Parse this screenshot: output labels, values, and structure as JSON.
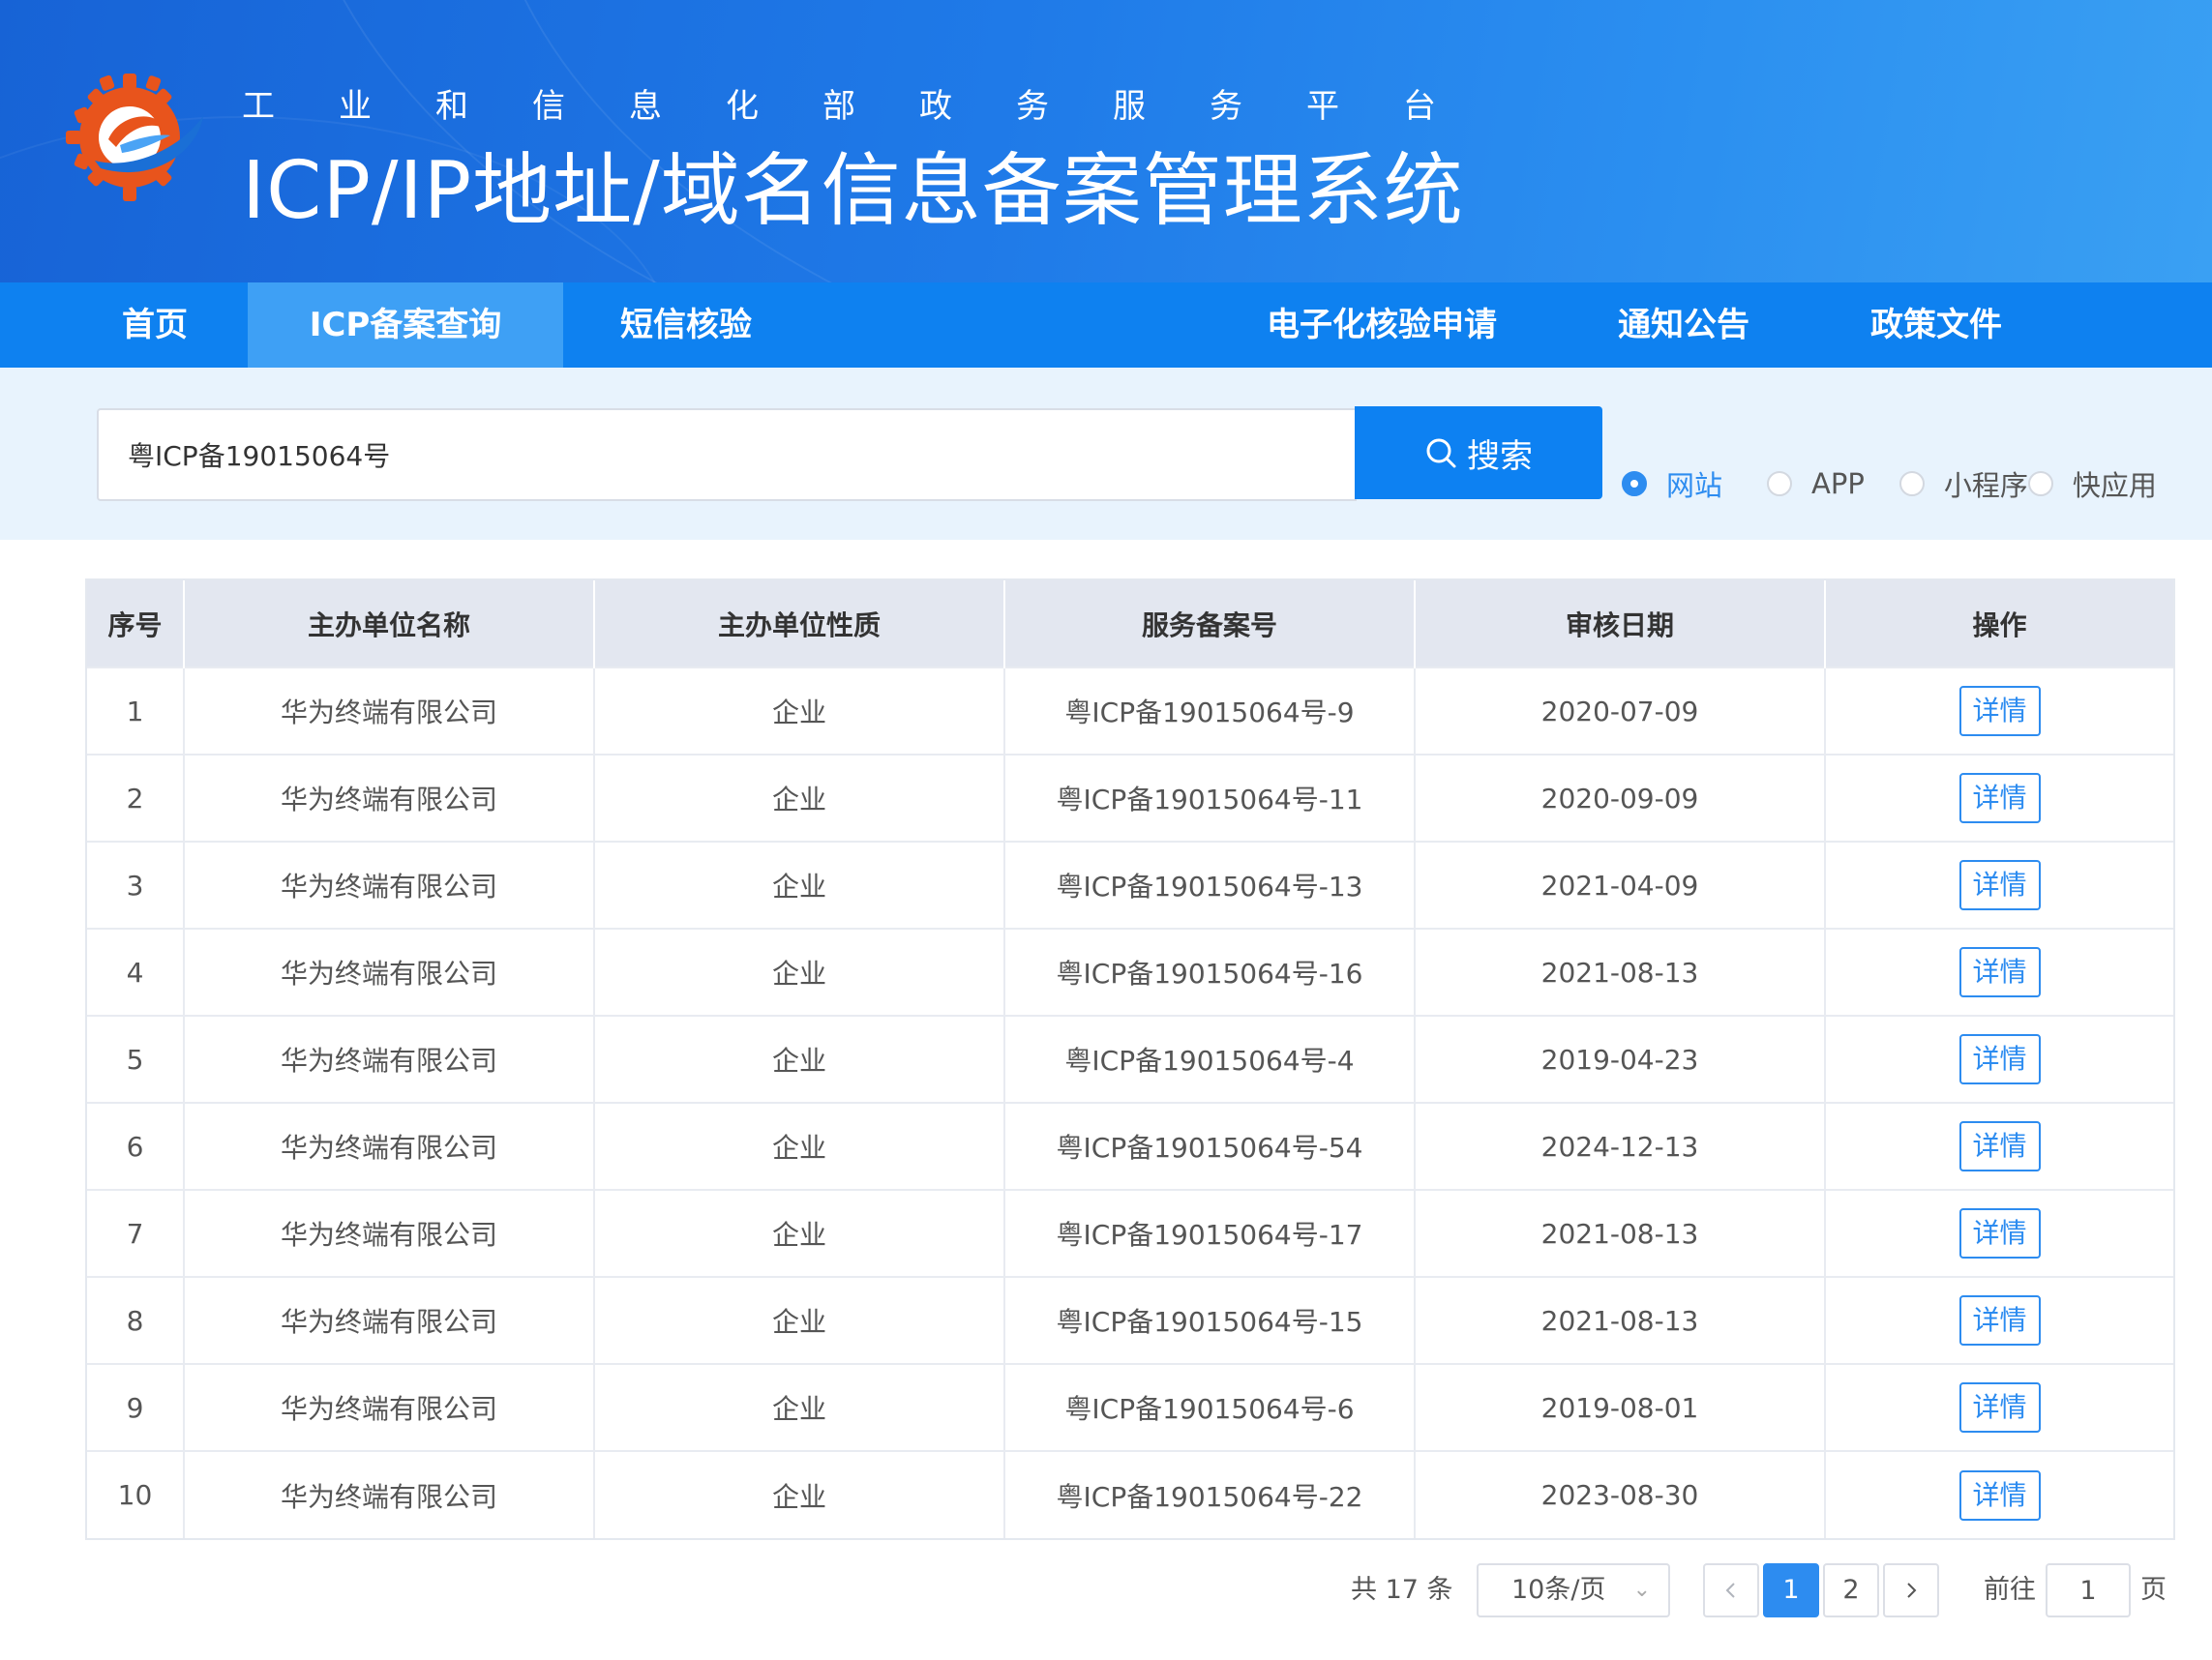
{
  "header": {
    "subtitle_chars": [
      "工",
      "业",
      "和",
      "信",
      "息",
      "化",
      "部",
      "政",
      "务",
      "服",
      "务",
      "平",
      "台"
    ],
    "title": "ICP/IP地址/域名信息备案管理系统",
    "logo_colors": {
      "gear": "#e8541c",
      "swoosh": "#1a6fd6"
    }
  },
  "nav": {
    "items": [
      "首页",
      "ICP备案查询",
      "短信核验",
      "电子化核验申请",
      "通知公告",
      "政策文件"
    ],
    "active_index": 1
  },
  "search": {
    "value": "粤ICP备19015064号",
    "button_label": "搜索",
    "types": [
      "网站",
      "APP",
      "小程序",
      "快应用"
    ],
    "selected_type": "网站"
  },
  "table": {
    "columns": [
      "序号",
      "主办单位名称",
      "主办单位性质",
      "服务备案号",
      "审核日期",
      "操作"
    ],
    "action_label": "详情",
    "rows": [
      {
        "index": "1",
        "name": "华为终端有限公司",
        "nature": "企业",
        "record": "粤ICP备19015064号-9",
        "date": "2020-07-09"
      },
      {
        "index": "2",
        "name": "华为终端有限公司",
        "nature": "企业",
        "record": "粤ICP备19015064号-11",
        "date": "2020-09-09"
      },
      {
        "index": "3",
        "name": "华为终端有限公司",
        "nature": "企业",
        "record": "粤ICP备19015064号-13",
        "date": "2021-04-09"
      },
      {
        "index": "4",
        "name": "华为终端有限公司",
        "nature": "企业",
        "record": "粤ICP备19015064号-16",
        "date": "2021-08-13"
      },
      {
        "index": "5",
        "name": "华为终端有限公司",
        "nature": "企业",
        "record": "粤ICP备19015064号-4",
        "date": "2019-04-23"
      },
      {
        "index": "6",
        "name": "华为终端有限公司",
        "nature": "企业",
        "record": "粤ICP备19015064号-54",
        "date": "2024-12-13"
      },
      {
        "index": "7",
        "name": "华为终端有限公司",
        "nature": "企业",
        "record": "粤ICP备19015064号-17",
        "date": "2021-08-13"
      },
      {
        "index": "8",
        "name": "华为终端有限公司",
        "nature": "企业",
        "record": "粤ICP备19015064号-15",
        "date": "2021-08-13"
      },
      {
        "index": "9",
        "name": "华为终端有限公司",
        "nature": "企业",
        "record": "粤ICP备19015064号-6",
        "date": "2019-08-01"
      },
      {
        "index": "10",
        "name": "华为终端有限公司",
        "nature": "企业",
        "record": "粤ICP备19015064号-22",
        "date": "2023-08-30"
      }
    ]
  },
  "pagination": {
    "total_label": "共 17 条",
    "page_size_label": "10条/页",
    "pages": [
      "1",
      "2"
    ],
    "current_page": "1",
    "goto_label": "前往",
    "goto_value": "1",
    "page_unit": "页",
    "prev_icon": "chevron-left-icon",
    "next_icon": "chevron-right-icon"
  },
  "colors": {
    "nav_bg": "#0e81f0",
    "nav_active": "#3ea0f5",
    "accent": "#2d8cf0",
    "search_band": "#e8f3fd"
  }
}
